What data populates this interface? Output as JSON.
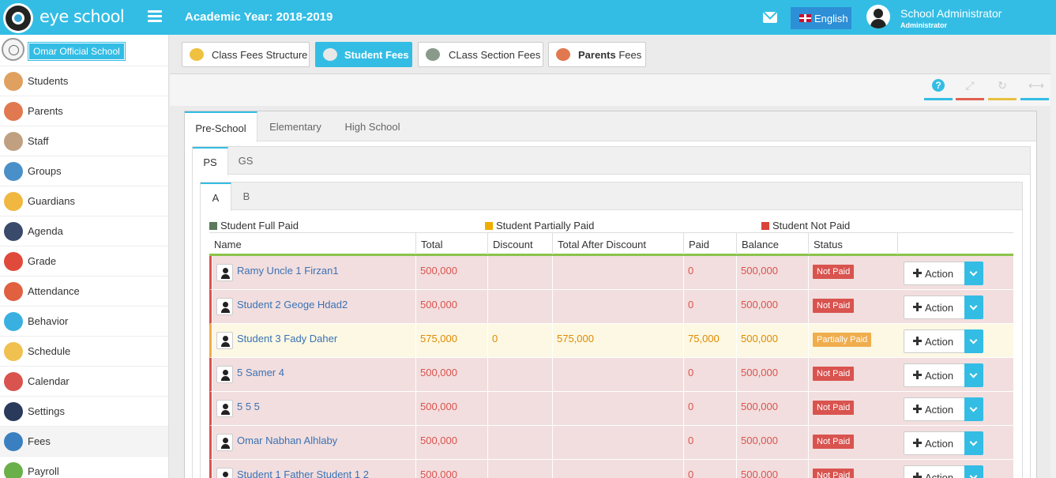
{
  "header": {
    "brand": "eye school",
    "academic_year": "Academic Year: 2018-2019",
    "language": "English",
    "user_name": "School Administrator",
    "user_role": "Administrator"
  },
  "sidebar": {
    "school_name": "Omar Official School",
    "items": [
      {
        "label": "Students",
        "icon": "students-icon",
        "color": "#e0a060"
      },
      {
        "label": "Parents",
        "icon": "parents-icon",
        "color": "#e07850"
      },
      {
        "label": "Staff",
        "icon": "staff-icon",
        "color": "#c0a080"
      },
      {
        "label": "Groups",
        "icon": "groups-icon",
        "color": "#4a90c8"
      },
      {
        "label": "Guardians",
        "icon": "guardians-icon",
        "color": "#f0b840"
      },
      {
        "label": "Agenda",
        "icon": "agenda-icon",
        "color": "#3a4a6a"
      },
      {
        "label": "Grade",
        "icon": "grade-icon",
        "color": "#e04a3a"
      },
      {
        "label": "Attendance",
        "icon": "attendance-icon",
        "color": "#e06040"
      },
      {
        "label": "Behavior",
        "icon": "behavior-icon",
        "color": "#3ab0e0"
      },
      {
        "label": "Schedule",
        "icon": "schedule-icon",
        "color": "#f0c050"
      },
      {
        "label": "Calendar",
        "icon": "calendar-icon",
        "color": "#d9534f"
      },
      {
        "label": "Settings",
        "icon": "settings-icon",
        "color": "#2a3a5a"
      },
      {
        "label": "Fees",
        "icon": "fees-icon",
        "color": "#3a80c0"
      },
      {
        "label": "Payroll",
        "icon": "payroll-icon",
        "color": "#6ab04a"
      }
    ]
  },
  "toolbar": {
    "buttons": [
      {
        "label": "Class Fees Structure",
        "icon": "glasses-icon"
      },
      {
        "label": "Student Fees",
        "icon": "student-icon"
      },
      {
        "label": "CLass Section Fees",
        "icon": "class-section-icon"
      },
      {
        "label_bold": "Parents",
        "label_rest": " Fees",
        "icon": "parents-icon"
      }
    ],
    "controls": [
      {
        "name": "help-icon",
        "symbol": "?",
        "color": "#33bde5"
      },
      {
        "name": "expand-icon",
        "symbol": "⤢",
        "color": "#e06050"
      },
      {
        "name": "refresh-icon",
        "symbol": "↻",
        "color": "#e8c040"
      },
      {
        "name": "resize-icon",
        "symbol": "⟷",
        "color": "#33bde5"
      }
    ]
  },
  "tabs_level1": [
    "Pre-School",
    "Elementary",
    "High School"
  ],
  "tabs_level2": [
    "PS",
    "GS"
  ],
  "tabs_level3": [
    "A",
    "B"
  ],
  "legend": {
    "full_paid": "Student Full Paid",
    "partially_paid": "Student Partially Paid",
    "not_paid": "Student Not Paid",
    "colors": {
      "full": "#5c7a5c",
      "partial": "#f0ad00",
      "not": "#d9433a"
    }
  },
  "table": {
    "columns": [
      "Name",
      "Total",
      "Discount",
      "Total After Discount",
      "Paid",
      "Balance",
      "Status",
      ""
    ],
    "action_label": "Action",
    "rows": [
      {
        "name": "Ramy Uncle 1 Firzan1",
        "total": "500,000",
        "discount": "",
        "after": "",
        "paid": "0",
        "balance": "500,000",
        "status": "Not Paid",
        "kind": "not-paid"
      },
      {
        "name": "Student 2 Geoge Hdad2",
        "total": "500,000",
        "discount": "",
        "after": "",
        "paid": "0",
        "balance": "500,000",
        "status": "Not Paid",
        "kind": "not-paid"
      },
      {
        "name": "Student 3 Fady Daher",
        "total": "575,000",
        "discount": "0",
        "after": "575,000",
        "paid": "75,000",
        "balance": "500,000",
        "status": "Partially Paid",
        "kind": "partial"
      },
      {
        "name": "5 Samer 4",
        "total": "500,000",
        "discount": "",
        "after": "",
        "paid": "0",
        "balance": "500,000",
        "status": "Not Paid",
        "kind": "not-paid"
      },
      {
        "name": "5 5 5",
        "total": "500,000",
        "discount": "",
        "after": "",
        "paid": "0",
        "balance": "500,000",
        "status": "Not Paid",
        "kind": "not-paid"
      },
      {
        "name": "Omar Nabhan Alhlaby",
        "total": "500,000",
        "discount": "",
        "after": "",
        "paid": "0",
        "balance": "500,000",
        "status": "Not Paid",
        "kind": "not-paid"
      },
      {
        "name": "Student 1 Father Student 1 2",
        "total": "500,000",
        "discount": "",
        "after": "",
        "paid": "0",
        "balance": "500,000",
        "status": "Not Paid",
        "kind": "not-paid"
      }
    ]
  }
}
